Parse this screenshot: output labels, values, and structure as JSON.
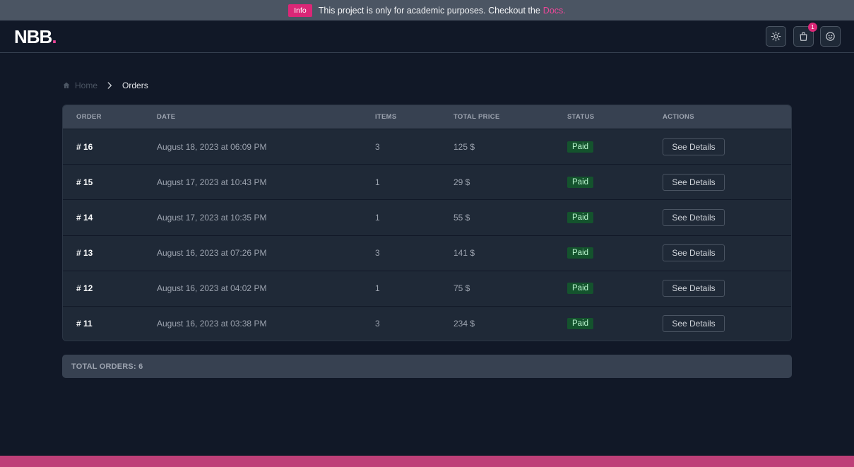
{
  "banner": {
    "badge": "Info",
    "text": "This project is only for academic purposes. Checkout the",
    "link": "Docs."
  },
  "navbar": {
    "logo": "NBB",
    "logo_dot": ".",
    "cart_count": "1",
    "icons": [
      "sun-icon",
      "shopping-bag-icon",
      "smiley-icon"
    ]
  },
  "breadcrumb": {
    "home": "Home",
    "current": "Orders"
  },
  "table": {
    "headers": {
      "order": "ORDER",
      "date": "DATE",
      "items": "ITEMS",
      "total_price": "TOTAL PRICE",
      "status": "STATUS",
      "actions": "ACTIONS"
    },
    "rows": [
      {
        "order": "# 16",
        "date": "August 18, 2023 at 06:09 PM",
        "items": "3",
        "price": "125 $",
        "status": "Paid",
        "action": "See Details"
      },
      {
        "order": "# 15",
        "date": "August 17, 2023 at 10:43 PM",
        "items": "1",
        "price": "29 $",
        "status": "Paid",
        "action": "See Details"
      },
      {
        "order": "# 14",
        "date": "August 17, 2023 at 10:35 PM",
        "items": "1",
        "price": "55 $",
        "status": "Paid",
        "action": "See Details"
      },
      {
        "order": "# 13",
        "date": "August 16, 2023 at 07:26 PM",
        "items": "3",
        "price": "141 $",
        "status": "Paid",
        "action": "See Details"
      },
      {
        "order": "# 12",
        "date": "August 16, 2023 at 04:02 PM",
        "items": "1",
        "price": "75 $",
        "status": "Paid",
        "action": "See Details"
      },
      {
        "order": "# 11",
        "date": "August 16, 2023 at 03:38 PM",
        "items": "3",
        "price": "234 $",
        "status": "Paid",
        "action": "See Details"
      }
    ]
  },
  "total": "TOTAL ORDERS: 6",
  "colors": {
    "accent": "#db2777",
    "paid_bg": "#14532d",
    "paid_text": "#bbf7d0"
  }
}
